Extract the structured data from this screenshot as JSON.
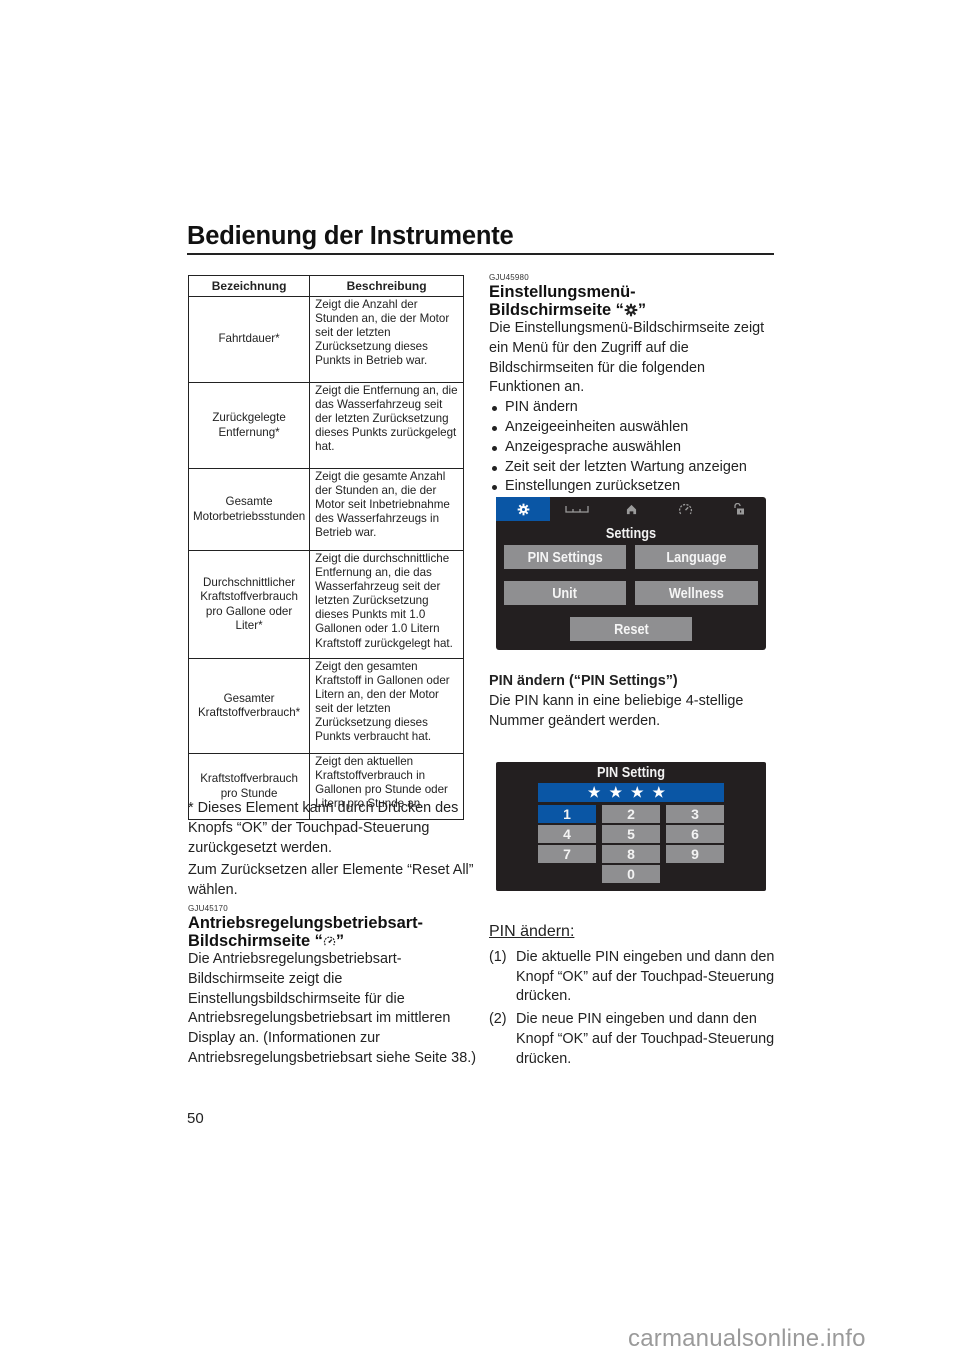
{
  "header": {
    "title": "Bedienung der Instrumente"
  },
  "table": {
    "headers": [
      "Bezeichnung",
      "Beschreibung"
    ],
    "rows": [
      {
        "name": "Fahrtdauer*",
        "desc": "Zeigt die Anzahl der Stunden an, die der Motor seit der letzten Zurücksetzung dieses Punkts in Betrieb war."
      },
      {
        "name": "Zurückgelegte Entfernung*",
        "desc": "Zeigt die Entfernung an, die das Wasserfahrzeug seit der letzten Zurücksetzung dieses Punkts zurückgelegt hat."
      },
      {
        "name": "Gesamte Motorbetriebsstunden",
        "desc": "Zeigt die gesamte Anzahl der Stunden an, die der Motor seit Inbetriebnahme des Wasserfahrzeugs in Betrieb war."
      },
      {
        "name": "Durchschnittlicher Kraftstoffverbrauch pro Gallone oder Liter*",
        "desc": "Zeigt die durchschnittliche Entfernung an, die das Wasserfahrzeug seit der letzten Zurücksetzung dieses Punkts mit 1.0 Gallonen oder 1.0 Litern Kraftstoff zurückgelegt hat."
      },
      {
        "name": "Gesamter Kraftstoffverbrauch*",
        "desc": "Zeigt den gesamten Kraftstoff in Gallonen oder Litern an, den der Motor seit der letzten Zurücksetzung dieses Punkts verbraucht hat."
      },
      {
        "name": "Kraftstoffverbrauch pro Stunde",
        "desc": "Zeigt den aktuellen Kraftstoffverbrauch in Gallonen pro Stunde oder Litern pro Stunde an."
      }
    ]
  },
  "left_column": {
    "footnote": "* Dieses Element kann durch Drücken des Knopfs “OK” der Touchpad-Steuerung zurückgesetzt werden.",
    "reset_all_note": "Zum Zurücksetzen aller Elemente “Reset All” wählen.",
    "section_code": "GJU45170",
    "section_title_line1": "Antriebsregelungsbetriebsart-",
    "section_title_line2_prefix": "Bildschirmseite “",
    "section_title_line2_suffix": "”",
    "section_body": "Die Antriebsregelungsbetriebsart-Bildschirmseite zeigt die Einstellungsbildschirmseite für die Antriebsregelungsbetriebsart im mittleren Display an. (Informationen zur Antriebsregelungsbetriebsart siehe Seite 38.)"
  },
  "right_column": {
    "section_code": "GJU45980",
    "section_title_line1": "Einstellungsmenü-",
    "section_title_line2_prefix": "Bildschirmseite “",
    "section_title_line2_suffix": "”",
    "intro": "Die Einstellungsmenü-Bildschirmseite zeigt ein Menü für den Zugriff auf die Bildschirmseiten für die folgenden Funktionen an.",
    "bullets": [
      "PIN ändern",
      "Anzeigeeinheiten auswählen",
      "Anzeigesprache auswählen",
      "Zeit seit der letzten Wartung anzeigen",
      "Einstellungen zurücksetzen"
    ],
    "pin_heading": "PIN ändern (“PIN Settings”)",
    "pin_body": "Die PIN kann in eine beliebige 4-stellige Nummer geändert werden.",
    "procedure_heading": "PIN ändern:",
    "steps": [
      {
        "num": "(1)",
        "text": "Die aktuelle PIN eingeben und dann den Knopf “OK” auf der Touchpad-Steuerung drücken."
      },
      {
        "num": "(2)",
        "text": "Die neue PIN eingeben und dann den Knopf “OK” auf der Touchpad-Steuerung drücken."
      }
    ]
  },
  "settings_screen": {
    "tabs": [
      {
        "icon": "gear-icon",
        "active": true
      },
      {
        "icon": "ruler-icon",
        "active": false
      },
      {
        "icon": "home-icon",
        "active": false
      },
      {
        "icon": "gauge-icon",
        "active": false
      },
      {
        "icon": "unlock-icon",
        "active": false
      }
    ],
    "title": "Settings",
    "buttons": {
      "pin_settings": "PIN Settings",
      "language": "Language",
      "unit": "Unit",
      "wellness": "Wellness",
      "reset": "Reset"
    },
    "colors": {
      "background": "#231f20",
      "accent": "#0a56a5",
      "button": "#8f8f91"
    }
  },
  "pin_screen": {
    "title": "PIN Setting",
    "masked_value": "****",
    "keys": [
      "1",
      "2",
      "3",
      "4",
      "5",
      "6",
      "7",
      "8",
      "9",
      "0"
    ],
    "selected_key": "1"
  },
  "footer": {
    "page_number": "50",
    "watermark": "carmanualsonline.info"
  }
}
